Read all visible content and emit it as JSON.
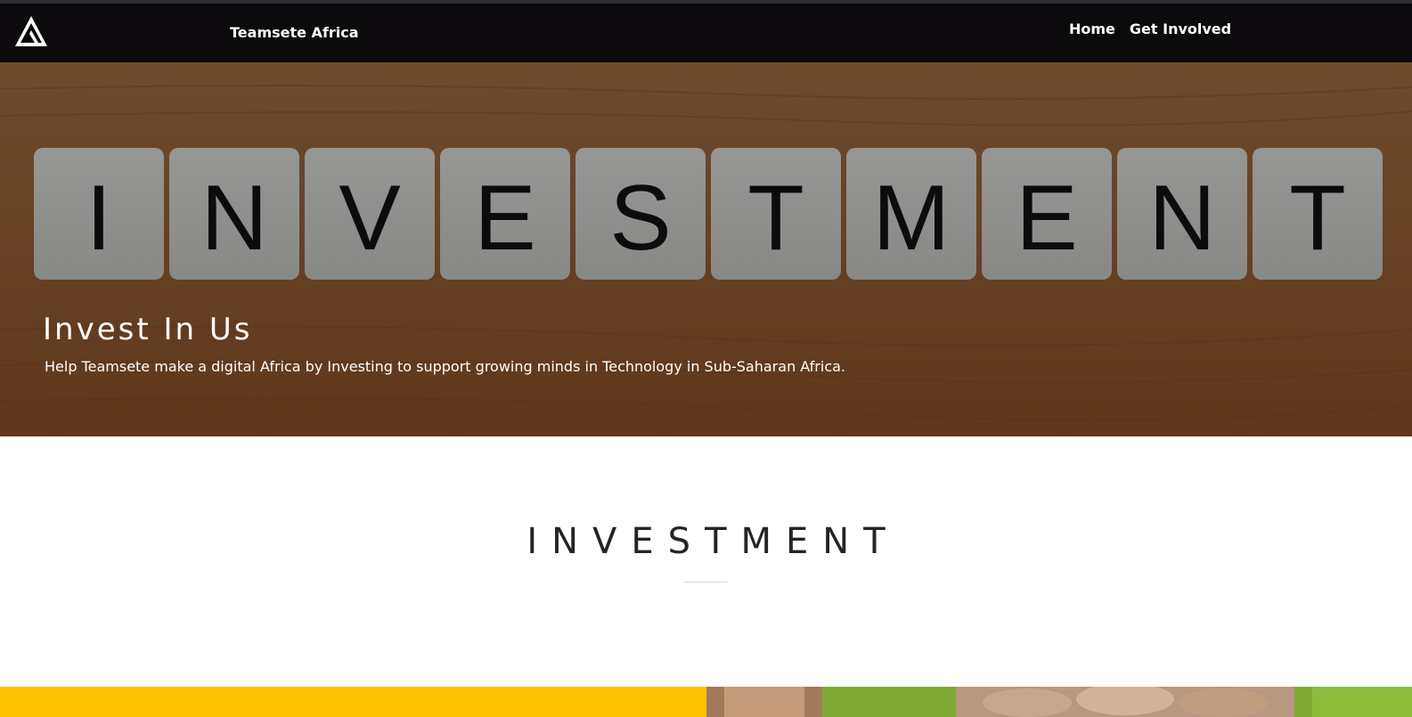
{
  "navbar": {
    "logo_icon": "triangle-logo-icon",
    "brand": "Teamsete Africa",
    "links": [
      "Home",
      "Get Involved"
    ]
  },
  "hero": {
    "image_word": "INVESTMENT",
    "title": "Invest In Us",
    "subtitle": "Help Teamsete make a digital Africa by Investing to support growing minds in Technology in Sub-Saharan Africa."
  },
  "section": {
    "title": "INVESTMENT"
  },
  "colors": {
    "navbar_bg": "#0c0a0c",
    "accent_yellow": "#ffc000",
    "heading_text": "#222428"
  }
}
